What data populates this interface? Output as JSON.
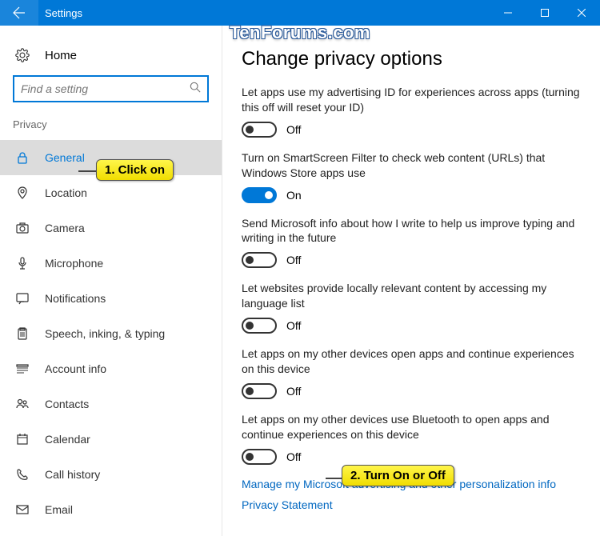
{
  "titlebar": {
    "title": "Settings"
  },
  "watermark": "TenForums.com",
  "sidebar": {
    "home_label": "Home",
    "search_placeholder": "Find a setting",
    "section_label": "Privacy",
    "items": [
      {
        "label": "General"
      },
      {
        "label": "Location"
      },
      {
        "label": "Camera"
      },
      {
        "label": "Microphone"
      },
      {
        "label": "Notifications"
      },
      {
        "label": "Speech, inking, & typing"
      },
      {
        "label": "Account info"
      },
      {
        "label": "Contacts"
      },
      {
        "label": "Calendar"
      },
      {
        "label": "Call history"
      },
      {
        "label": "Email"
      }
    ]
  },
  "main": {
    "page_title": "Change privacy options",
    "settings": [
      {
        "desc": "Let apps use my advertising ID for experiences across apps (turning this off will reset your ID)",
        "state": "Off"
      },
      {
        "desc": "Turn on SmartScreen Filter to check web content (URLs) that Windows Store apps use",
        "state": "On"
      },
      {
        "desc": "Send Microsoft info about how I write to help us improve typing and writing in the future",
        "state": "Off"
      },
      {
        "desc": "Let websites provide locally relevant content by accessing my language list",
        "state": "Off"
      },
      {
        "desc": "Let apps on my other devices open apps and continue experiences on this device",
        "state": "Off"
      },
      {
        "desc": "Let apps on my other devices use Bluetooth to open apps and continue experiences on this device",
        "state": "Off"
      }
    ],
    "links": [
      "Manage my Microsoft advertising and other personalization info",
      "Privacy Statement"
    ]
  },
  "callouts": {
    "c1": "1. Click on",
    "c2": "2. Turn On or Off"
  }
}
